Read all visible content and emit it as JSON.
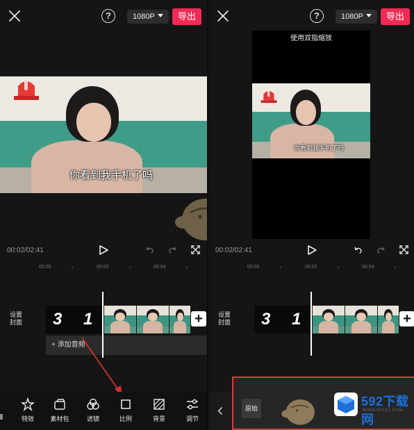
{
  "left_panel": {
    "topbar": {
      "help_glyph": "?",
      "resolution": "1080P",
      "export_label": "导出"
    },
    "subtitle": "你看到我手机了吗",
    "timecode": "00:02/02:41",
    "ruler": [
      "00:00",
      "00:02",
      "00:04"
    ],
    "cover_label": "设置\n封面",
    "clip_numbers": [
      "3",
      "1"
    ],
    "add_audio_label": "添加音频",
    "toolbar": [
      {
        "label": "特效",
        "icon": "effects-icon"
      },
      {
        "label": "素材包",
        "icon": "material-pack-icon"
      },
      {
        "label": "滤镜",
        "icon": "filter-icon"
      },
      {
        "label": "比例",
        "icon": "ratio-icon"
      },
      {
        "label": "背景",
        "icon": "background-icon"
      },
      {
        "label": "调节",
        "icon": "adjust-icon"
      }
    ]
  },
  "right_panel": {
    "topbar": {
      "help_glyph": "?",
      "resolution": "1080P",
      "export_label": "导出"
    },
    "hint": "使用双指缩放",
    "subtitle": "你看到我手机了吗",
    "timecode": "00:02/02:41",
    "ruler": [
      "00:00",
      "00:02",
      "00:04"
    ],
    "cover_label": "设置\n封面",
    "clip_numbers": [
      "3",
      "1"
    ],
    "ratio_option": "原始"
  },
  "watermark": {
    "brand": "592下载网",
    "url": "WWW.592XZ.COM"
  },
  "colors": {
    "accent": "#ef2b55",
    "highlight_red": "#e53935",
    "brand_blue": "#1d6fd8"
  }
}
